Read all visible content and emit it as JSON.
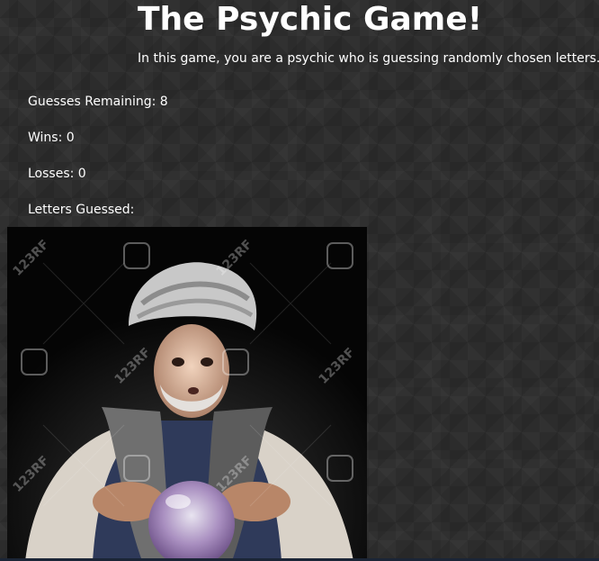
{
  "header": {
    "title": "The Psychic Game!",
    "subtitle": "In this game, you are a psychic who is guessing randomly chosen letters."
  },
  "stats": {
    "guesses_label": "Guesses Remaining: 8",
    "wins_label": "Wins: 0",
    "losses_label": "Losses: 0",
    "letters_label": "Letters Guessed:"
  },
  "image": {
    "subject": "fortune teller in turban with crystal ball",
    "watermark_text": "123RF"
  }
}
